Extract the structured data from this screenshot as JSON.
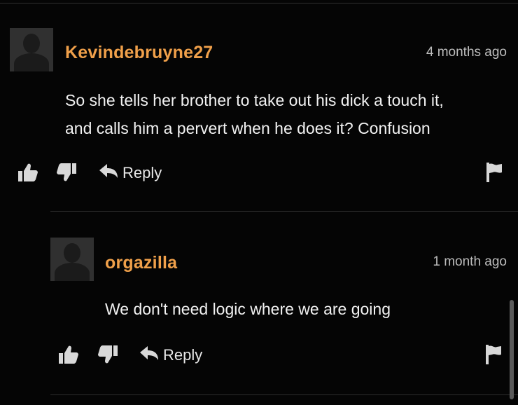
{
  "comments": [
    {
      "username": "Kevindebruyne27",
      "timestamp": "4 months ago",
      "text_lines": [
        "So she tells her brother to take out his dick a touch it,",
        "and calls him a pervert when he does it? Confusion"
      ],
      "reply_label": "Reply"
    },
    {
      "username": "orgazilla",
      "timestamp": "1 month ago",
      "text_lines": [
        "We don't need logic where we are going"
      ],
      "reply_label": "Reply"
    }
  ],
  "icons": {
    "like": "thumbs-up-icon",
    "dislike": "thumbs-down-icon",
    "reply": "reply-arrow-icon",
    "flag": "flag-icon"
  },
  "colors": {
    "background": "#050505",
    "username": "#f0a04a",
    "text": "#f2f2f2",
    "timestamp": "#bdbdbd",
    "icon": "#d8d8d8"
  }
}
